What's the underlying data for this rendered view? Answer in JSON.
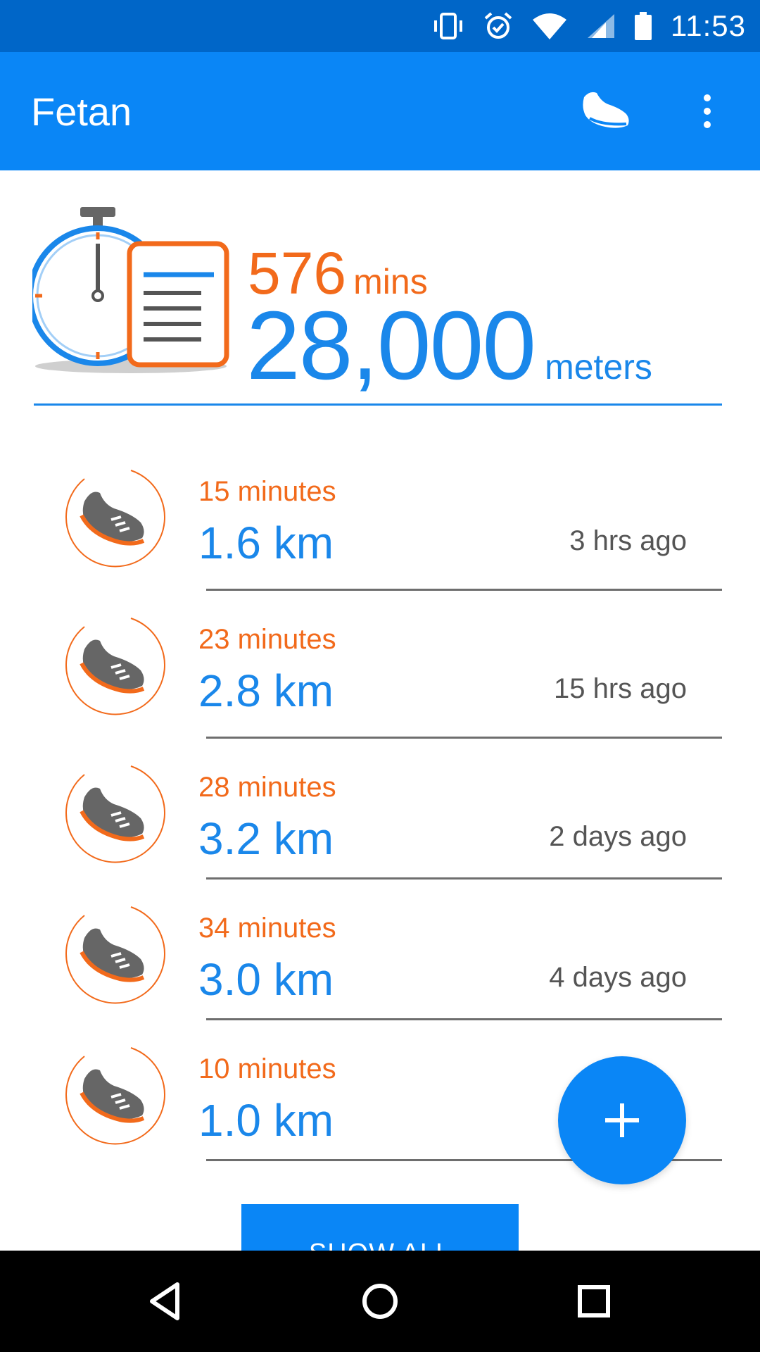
{
  "status_bar": {
    "time": "11:53",
    "icons": [
      "vibrate-icon",
      "alarm-icon",
      "wifi-icon",
      "signal-icon",
      "battery-icon"
    ]
  },
  "app_bar": {
    "title": "Fetan",
    "actions": [
      "shoe-icon",
      "overflow-menu-icon"
    ]
  },
  "summary": {
    "minutes": "576",
    "minutes_unit": "mins",
    "distance": "28,000",
    "distance_unit": "meters"
  },
  "activities": [
    {
      "minutes": "15 minutes",
      "distance": "1.6 km",
      "ago": "3 hrs ago"
    },
    {
      "minutes": "23 minutes",
      "distance": "2.8 km",
      "ago": "15 hrs ago"
    },
    {
      "minutes": "28 minutes",
      "distance": "3.2 km",
      "ago": "2 days ago"
    },
    {
      "minutes": "34 minutes",
      "distance": "3.0 km",
      "ago": "4 days ago"
    },
    {
      "minutes": "10 minutes",
      "distance": "1.0 km",
      "ago": ""
    }
  ],
  "show_all_label": "SHOW ALL",
  "fab_icon": "plus-icon",
  "nav_bar": [
    "back-icon",
    "home-icon",
    "recents-icon"
  ],
  "colors": {
    "status_bar": "#0066c8",
    "app_bar": "#0a86f6",
    "accent_blue": "#1a87ea",
    "accent_orange": "#f26a1b"
  }
}
